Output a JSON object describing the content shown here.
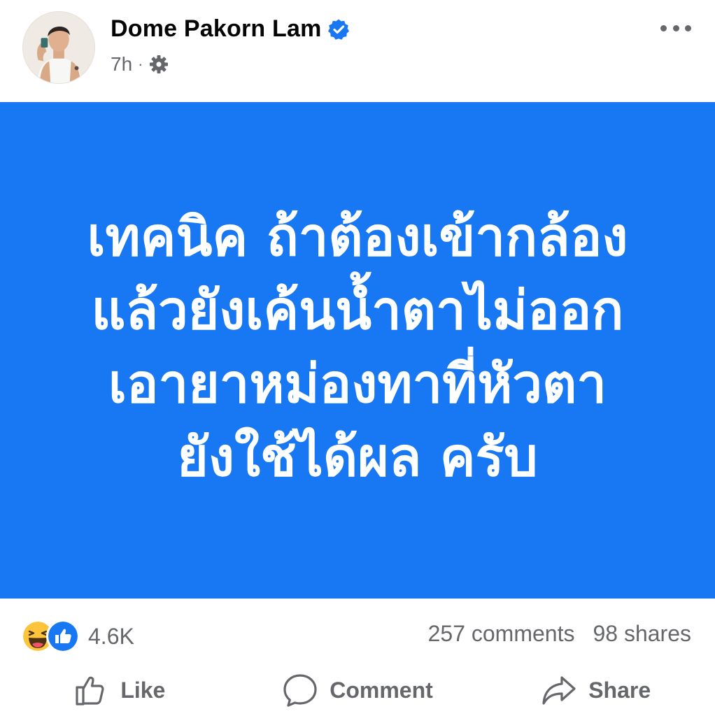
{
  "post": {
    "author": "Dome Pakorn Lam",
    "time": "7h",
    "separator": "·",
    "body_text": "เทคนิค ถ้าต้องเข้ากล้อง\nแล้วยังเค้นน้ำตาไม่ออก\nเอายาหม่องทาที่หัวตา\nยังใช้ได้ผล  ครับ",
    "background_color": "#1877f2"
  },
  "icons": {
    "verified": "verified-badge-icon",
    "privacy": "gear-icon",
    "more": "more-options-icon",
    "reaction_1": "haha-reaction-icon",
    "reaction_2": "like-reaction-icon"
  },
  "stats": {
    "reactions_count": "4.6K",
    "comments": "257 comments",
    "shares": "98 shares"
  },
  "actions": {
    "like": "Like",
    "comment": "Comment",
    "share": "Share"
  },
  "colors": {
    "accent": "#1877f2",
    "secondary_text": "#65676b"
  }
}
